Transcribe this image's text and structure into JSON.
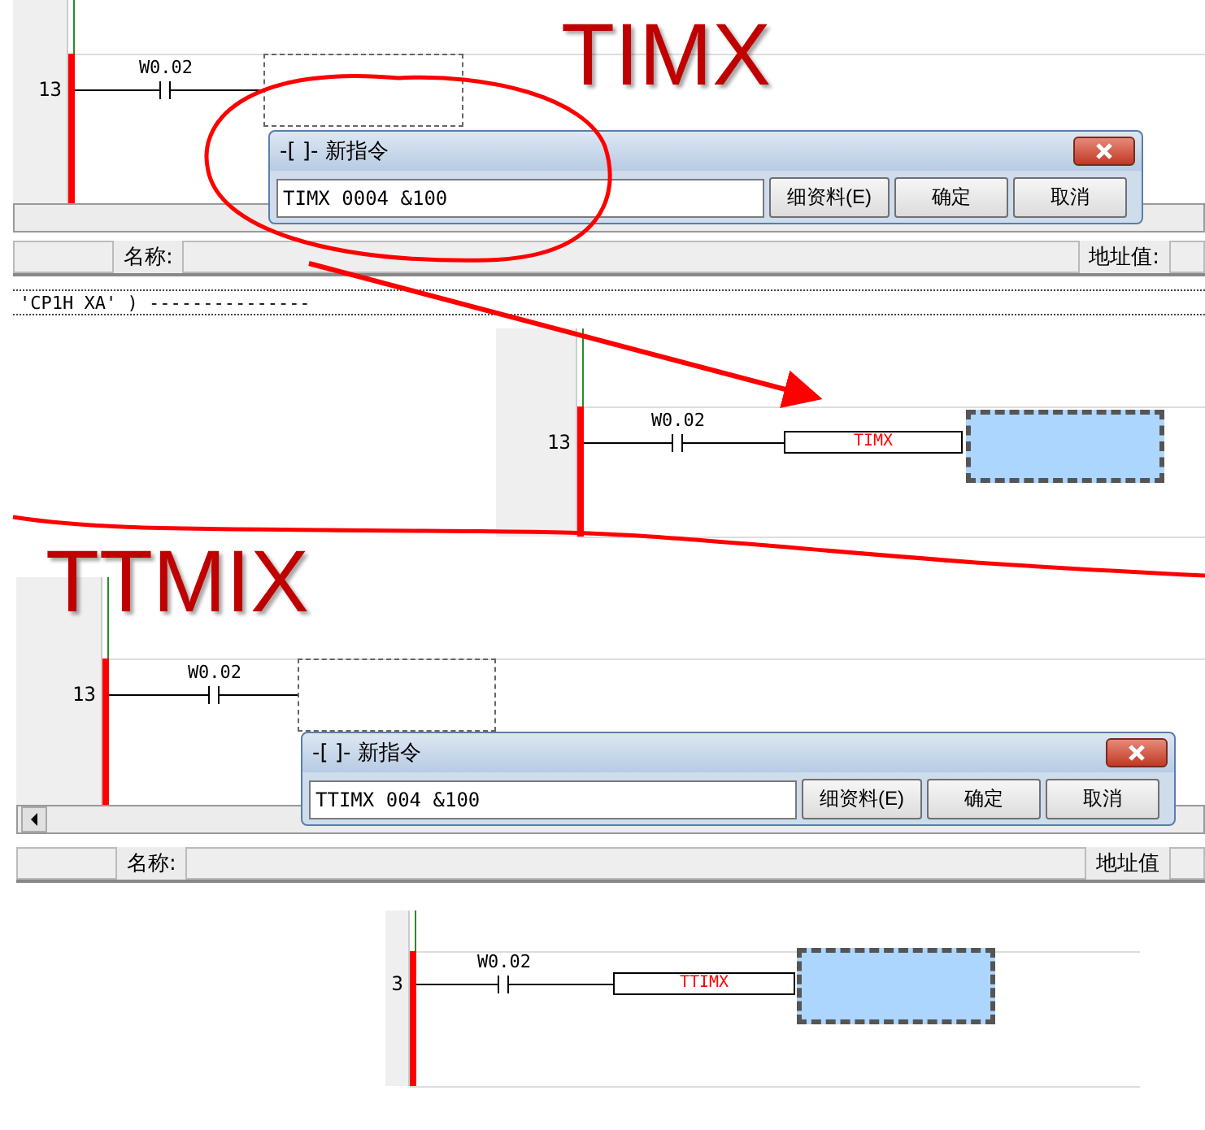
{
  "annotations": [
    {
      "text": "TIMX"
    },
    {
      "text": "TTMIX"
    }
  ],
  "comment_line": "'CP1H XA' ) ---------------",
  "steps": [
    {
      "kind": "dialog",
      "rung_number": "13",
      "contact_label": "W0.02",
      "dialog": {
        "title": "-[ ]- 新指令",
        "value": "TIMX 0004 &100",
        "buttons": [
          "细资料(E)",
          "确定",
          "取消"
        ]
      },
      "status_bar": {
        "name_label": "名称:",
        "address_label": "地址值:"
      }
    },
    {
      "kind": "result",
      "rung_number": "13",
      "contact_label": "W0.02",
      "instruction": "TIMX"
    },
    {
      "kind": "dialog",
      "rung_number": "13",
      "contact_label": "W0.02",
      "dialog": {
        "title": "-[ ]- 新指令",
        "value": "TTIMX 004 &100",
        "buttons": [
          "细资料(E)",
          "确定",
          "取消"
        ]
      },
      "status_bar": {
        "name_label": "名称:",
        "address_label": "地址值"
      }
    },
    {
      "kind": "result",
      "rung_number": "3",
      "contact_label": "W0.02",
      "instruction": "TTIMX"
    }
  ]
}
